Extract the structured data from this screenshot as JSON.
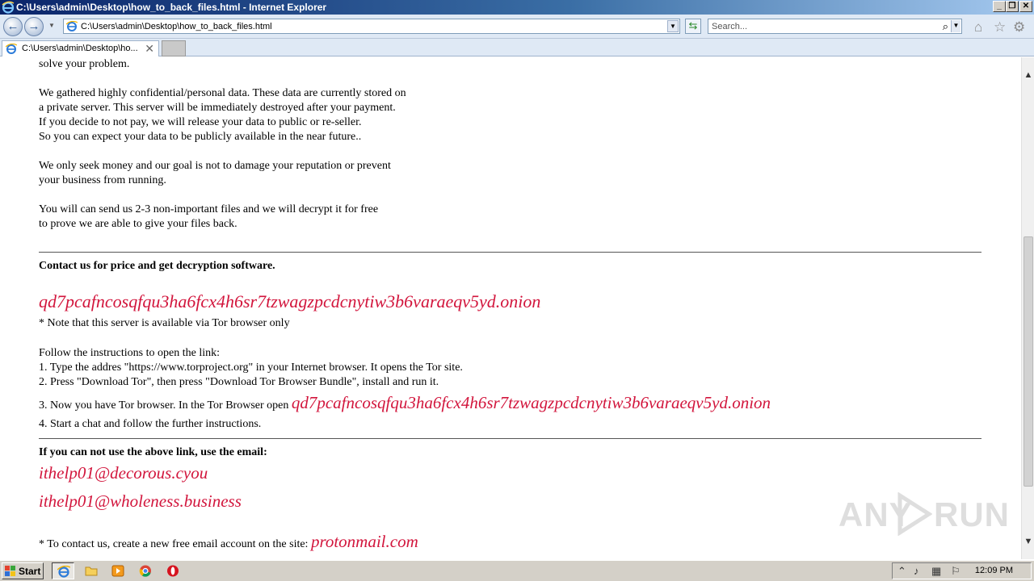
{
  "window": {
    "title": "C:\\Users\\admin\\Desktop\\how_to_back_files.html - Internet Explorer",
    "min_label": "_",
    "restore_label": "❐",
    "close_label": "✕"
  },
  "toolbar": {
    "back_glyph": "←",
    "forward_glyph": "→",
    "address": "C:\\Users\\admin\\Desktop\\how_to_back_files.html",
    "dropdown_glyph": "▼",
    "refresh_glyph": "⇆",
    "search_placeholder": "Search...",
    "search_glyph": "⌕",
    "home_glyph": "⌂",
    "favorites_glyph": "☆",
    "tools_glyph": "⚙"
  },
  "tab": {
    "label": "C:\\Users\\admin\\Desktop\\ho...",
    "close_glyph": "✕"
  },
  "content": {
    "intro_tail": "solve your problem.",
    "para1": [
      "We gathered highly confidential/personal data. These data are currently stored on",
      "a private server. This server will be immediately destroyed after your payment.",
      "If you decide to not pay, we will release your data to public or re-seller.",
      "So you can expect your data to be publicly available in the near future.."
    ],
    "para2": [
      "We only seek money and our goal is not to damage your reputation or prevent",
      "your business from running."
    ],
    "para3": [
      "You will can send us 2-3 non-important files and we will decrypt it for free",
      "to prove we are able to give your files back."
    ],
    "contact_heading": "Contact us for price and get decryption software.",
    "onion": "qd7pcafncosqfqu3ha6fcx4h6sr7tzwagzpcdcnytiw3b6varaeqv5yd.onion",
    "tor_note": "* Note that this server is available via Tor browser only",
    "instructions_heading": "Follow the instructions to open the link:",
    "step1": "1. Type the addres \"https://www.torproject.org\" in your Internet browser. It opens the Tor site.",
    "step2": "2. Press \"Download Tor\", then press \"Download Tor Browser Bundle\", install and run it.",
    "step3_prefix": "3. Now you have Tor browser. In the Tor Browser open ",
    "step3_onion": "qd7pcafncosqfqu3ha6fcx4h6sr7tzwagzpcdcnytiw3b6varaeqv5yd.onion",
    "step4": "4. Start a chat and follow the further instructions.",
    "email_heading": "If you can not use the above link, use the email:",
    "email1": "ithelp01@decorous.cyou",
    "email2": "ithelp01@wholeness.business",
    "proton_prefix": "* To contact us, create a new free email account on the site: ",
    "proton_link": "protonmail.com"
  },
  "scrollbar": {
    "up_glyph": "▲",
    "down_glyph": "▼"
  },
  "watermark": {
    "left_text": "ANY",
    "right_text": "RUN"
  },
  "taskbar": {
    "start_label": "Start",
    "clock": "12:09 PM",
    "tray_up_glyph": "⌃",
    "tray_volume_glyph": "♪",
    "tray_network_glyph": "▦",
    "tray_flag_glyph": "⚐"
  }
}
